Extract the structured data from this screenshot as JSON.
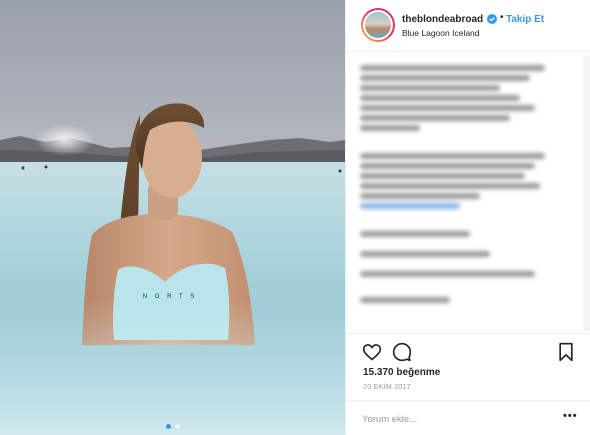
{
  "post": {
    "username": "theblondeabroad",
    "separator": "•",
    "follow_label": "Takip Et",
    "location": "Blue Lagoon Iceland",
    "likes": "15.370 beğenme",
    "date": "20 EKİM 2017",
    "comment_placeholder": "Yorum ekle...",
    "more_label": "•••",
    "carousel": {
      "count": 2,
      "active_index": 0
    }
  },
  "icons": {
    "verified": "verified-badge-icon",
    "like": "heart-icon",
    "comment": "comment-bubble-icon",
    "save": "bookmark-icon"
  },
  "colors": {
    "link_blue": "#3897f0",
    "text": "#262626",
    "muted": "#999999",
    "border": "#efefef",
    "lagoon": "#a9d4dc"
  }
}
